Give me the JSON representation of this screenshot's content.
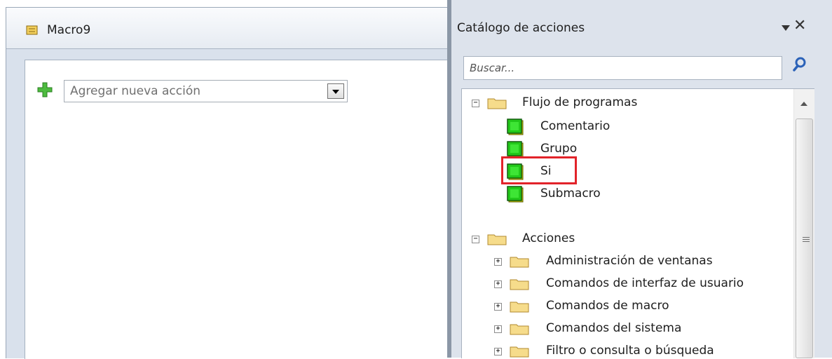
{
  "macro": {
    "tab_title": "Macro9",
    "add_action_label": "Agregar nueva acción"
  },
  "catalog": {
    "title": "Catálogo de acciones",
    "search_placeholder": "Buscar..."
  },
  "tree": {
    "program_flow": {
      "label": "Flujo de programas",
      "items": [
        "Comentario",
        "Grupo",
        "Si",
        "Submacro"
      ]
    },
    "actions": {
      "label": "Acciones",
      "items": [
        "Administración de ventanas",
        "Comandos de interfaz de usuario",
        "Comandos de macro",
        "Comandos del sistema",
        "Filtro o consulta o búsqueda"
      ]
    }
  },
  "colors": {
    "highlight": "#e2232a",
    "accent": "#2b62b8",
    "action_green": "#22c81a"
  },
  "icons": {
    "macro": "macro-scroll-icon",
    "add": "plus-icon",
    "search": "magnifier-icon",
    "folder": "folder-icon",
    "action": "action-block-icon"
  }
}
